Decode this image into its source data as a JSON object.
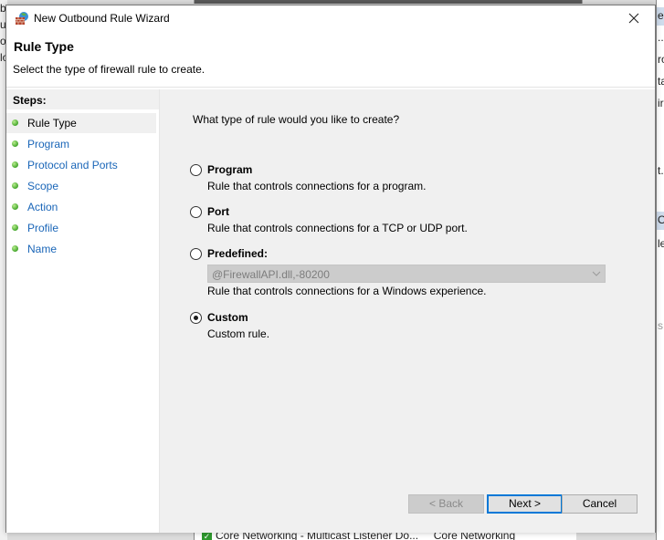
{
  "background": {
    "left_fragments": [
      "b",
      "u",
      "o",
      "lo"
    ],
    "right_fragments": [
      "es",
      "...",
      "ro",
      "ta",
      "iro",
      "t.",
      "O",
      "le",
      "s"
    ],
    "bottom_row": {
      "name": "Core Networking - Multicast Listener Do...",
      "group": "Core Networking"
    }
  },
  "window": {
    "title": "New Outbound Rule Wizard",
    "icon": "firewall-icon",
    "close_icon": "close-icon"
  },
  "header": {
    "title": "Rule Type",
    "subtitle": "Select the type of firewall rule to create."
  },
  "steps": {
    "heading": "Steps:",
    "items": [
      {
        "label": "Rule Type",
        "active": true
      },
      {
        "label": "Program",
        "active": false
      },
      {
        "label": "Protocol and Ports",
        "active": false
      },
      {
        "label": "Scope",
        "active": false
      },
      {
        "label": "Action",
        "active": false
      },
      {
        "label": "Profile",
        "active": false
      },
      {
        "label": "Name",
        "active": false
      }
    ]
  },
  "main": {
    "question": "What type of rule would you like to create?",
    "options": [
      {
        "label": "Program",
        "description": "Rule that controls connections for a program.",
        "checked": false
      },
      {
        "label": "Port",
        "description": "Rule that controls connections for a TCP or UDP port.",
        "checked": false
      },
      {
        "label": "Predefined:",
        "description": "Rule that controls connections for a Windows experience.",
        "checked": false
      },
      {
        "label": "Custom",
        "description": "Custom rule.",
        "checked": true
      }
    ],
    "predefined_select": {
      "value": "@FirewallAPI.dll,-80200",
      "disabled": true
    }
  },
  "buttons": {
    "back": "< Back",
    "next": "Next >",
    "cancel": "Cancel"
  },
  "colors": {
    "link": "#1a66b8",
    "accent": "#0078d7",
    "panel": "#f0f0f0"
  }
}
